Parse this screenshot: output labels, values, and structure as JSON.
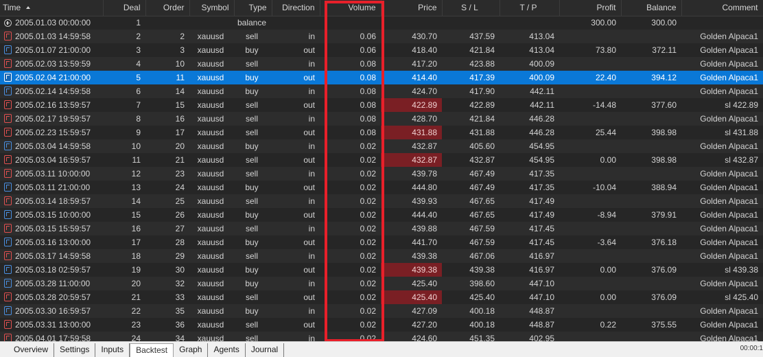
{
  "columns": {
    "time": "Time",
    "deal": "Deal",
    "order": "Order",
    "symbol": "Symbol",
    "type": "Type",
    "direction": "Direction",
    "volume": "Volume",
    "price": "Price",
    "sl": "S / L",
    "tp": "T / P",
    "profit": "Profit",
    "balance": "Balance",
    "comment": "Comment"
  },
  "rows": [
    {
      "icon": "balance",
      "time": "2005.01.03 00:00:00",
      "deal": "1",
      "order": "",
      "symbol": "",
      "type": "balance",
      "direction": "",
      "volume": "",
      "price": "",
      "sl": "",
      "tp": "",
      "profit": "300.00",
      "balance": "300.00",
      "comment": "",
      "selected": false,
      "loss": false
    },
    {
      "icon": "sell",
      "time": "2005.01.03 14:59:58",
      "deal": "2",
      "order": "2",
      "symbol": "xauusd",
      "type": "sell",
      "direction": "in",
      "volume": "0.06",
      "price": "430.70",
      "sl": "437.59",
      "tp": "413.04",
      "profit": "",
      "balance": "",
      "comment": "Golden Alpaca1",
      "selected": false,
      "loss": false
    },
    {
      "icon": "buy",
      "time": "2005.01.07 21:00:00",
      "deal": "3",
      "order": "3",
      "symbol": "xauusd",
      "type": "buy",
      "direction": "out",
      "volume": "0.06",
      "price": "418.40",
      "sl": "421.84",
      "tp": "413.04",
      "profit": "73.80",
      "balance": "372.11",
      "comment": "Golden Alpaca1",
      "selected": false,
      "loss": false
    },
    {
      "icon": "sell",
      "time": "2005.02.03 13:59:59",
      "deal": "4",
      "order": "10",
      "symbol": "xauusd",
      "type": "sell",
      "direction": "in",
      "volume": "0.08",
      "price": "417.20",
      "sl": "423.88",
      "tp": "400.09",
      "profit": "",
      "balance": "",
      "comment": "Golden Alpaca1",
      "selected": false,
      "loss": false
    },
    {
      "icon": "buy",
      "time": "2005.02.04 21:00:00",
      "deal": "5",
      "order": "11",
      "symbol": "xauusd",
      "type": "buy",
      "direction": "out",
      "volume": "0.08",
      "price": "414.40",
      "sl": "417.39",
      "tp": "400.09",
      "profit": "22.40",
      "balance": "394.12",
      "comment": "Golden Alpaca1",
      "selected": true,
      "loss": false
    },
    {
      "icon": "buy",
      "time": "2005.02.14 14:59:58",
      "deal": "6",
      "order": "14",
      "symbol": "xauusd",
      "type": "buy",
      "direction": "in",
      "volume": "0.08",
      "price": "424.70",
      "sl": "417.90",
      "tp": "442.11",
      "profit": "",
      "balance": "",
      "comment": "Golden Alpaca1",
      "selected": false,
      "loss": false
    },
    {
      "icon": "sell",
      "time": "2005.02.16 13:59:57",
      "deal": "7",
      "order": "15",
      "symbol": "xauusd",
      "type": "sell",
      "direction": "out",
      "volume": "0.08",
      "price": "422.89",
      "sl": "422.89",
      "tp": "442.11",
      "profit": "-14.48",
      "balance": "377.60",
      "comment": "sl 422.89",
      "selected": false,
      "loss": true
    },
    {
      "icon": "sell",
      "time": "2005.02.17 19:59:57",
      "deal": "8",
      "order": "16",
      "symbol": "xauusd",
      "type": "sell",
      "direction": "in",
      "volume": "0.08",
      "price": "428.70",
      "sl": "421.84",
      "tp": "446.28",
      "profit": "",
      "balance": "",
      "comment": "Golden Alpaca1",
      "selected": false,
      "loss": false
    },
    {
      "icon": "sell",
      "time": "2005.02.23 15:59:57",
      "deal": "9",
      "order": "17",
      "symbol": "xauusd",
      "type": "sell",
      "direction": "out",
      "volume": "0.08",
      "price": "431.88",
      "sl": "431.88",
      "tp": "446.28",
      "profit": "25.44",
      "balance": "398.98",
      "comment": "sl 431.88",
      "selected": false,
      "loss": true
    },
    {
      "icon": "buy",
      "time": "2005.03.04 14:59:58",
      "deal": "10",
      "order": "20",
      "symbol": "xauusd",
      "type": "buy",
      "direction": "in",
      "volume": "0.02",
      "price": "432.87",
      "sl": "405.60",
      "tp": "454.95",
      "profit": "",
      "balance": "",
      "comment": "Golden Alpaca1",
      "selected": false,
      "loss": false
    },
    {
      "icon": "sell",
      "time": "2005.03.04 16:59:57",
      "deal": "11",
      "order": "21",
      "symbol": "xauusd",
      "type": "sell",
      "direction": "out",
      "volume": "0.02",
      "price": "432.87",
      "sl": "432.87",
      "tp": "454.95",
      "profit": "0.00",
      "balance": "398.98",
      "comment": "sl 432.87",
      "selected": false,
      "loss": true
    },
    {
      "icon": "sell",
      "time": "2005.03.11 10:00:00",
      "deal": "12",
      "order": "23",
      "symbol": "xauusd",
      "type": "sell",
      "direction": "in",
      "volume": "0.02",
      "price": "439.78",
      "sl": "467.49",
      "tp": "417.35",
      "profit": "",
      "balance": "",
      "comment": "Golden Alpaca1",
      "selected": false,
      "loss": false
    },
    {
      "icon": "buy",
      "time": "2005.03.11 21:00:00",
      "deal": "13",
      "order": "24",
      "symbol": "xauusd",
      "type": "buy",
      "direction": "out",
      "volume": "0.02",
      "price": "444.80",
      "sl": "467.49",
      "tp": "417.35",
      "profit": "-10.04",
      "balance": "388.94",
      "comment": "Golden Alpaca1",
      "selected": false,
      "loss": false
    },
    {
      "icon": "sell",
      "time": "2005.03.14 18:59:57",
      "deal": "14",
      "order": "25",
      "symbol": "xauusd",
      "type": "sell",
      "direction": "in",
      "volume": "0.02",
      "price": "439.93",
      "sl": "467.65",
      "tp": "417.49",
      "profit": "",
      "balance": "",
      "comment": "Golden Alpaca1",
      "selected": false,
      "loss": false
    },
    {
      "icon": "buy",
      "time": "2005.03.15 10:00:00",
      "deal": "15",
      "order": "26",
      "symbol": "xauusd",
      "type": "buy",
      "direction": "out",
      "volume": "0.02",
      "price": "444.40",
      "sl": "467.65",
      "tp": "417.49",
      "profit": "-8.94",
      "balance": "379.91",
      "comment": "Golden Alpaca1",
      "selected": false,
      "loss": false
    },
    {
      "icon": "sell",
      "time": "2005.03.15 15:59:57",
      "deal": "16",
      "order": "27",
      "symbol": "xauusd",
      "type": "sell",
      "direction": "in",
      "volume": "0.02",
      "price": "439.88",
      "sl": "467.59",
      "tp": "417.45",
      "profit": "",
      "balance": "",
      "comment": "Golden Alpaca1",
      "selected": false,
      "loss": false
    },
    {
      "icon": "buy",
      "time": "2005.03.16 13:00:00",
      "deal": "17",
      "order": "28",
      "symbol": "xauusd",
      "type": "buy",
      "direction": "out",
      "volume": "0.02",
      "price": "441.70",
      "sl": "467.59",
      "tp": "417.45",
      "profit": "-3.64",
      "balance": "376.18",
      "comment": "Golden Alpaca1",
      "selected": false,
      "loss": false
    },
    {
      "icon": "sell",
      "time": "2005.03.17 14:59:58",
      "deal": "18",
      "order": "29",
      "symbol": "xauusd",
      "type": "sell",
      "direction": "in",
      "volume": "0.02",
      "price": "439.38",
      "sl": "467.06",
      "tp": "416.97",
      "profit": "",
      "balance": "",
      "comment": "Golden Alpaca1",
      "selected": false,
      "loss": false
    },
    {
      "icon": "buy",
      "time": "2005.03.18 02:59:57",
      "deal": "19",
      "order": "30",
      "symbol": "xauusd",
      "type": "buy",
      "direction": "out",
      "volume": "0.02",
      "price": "439.38",
      "sl": "439.38",
      "tp": "416.97",
      "profit": "0.00",
      "balance": "376.09",
      "comment": "sl 439.38",
      "selected": false,
      "loss": true
    },
    {
      "icon": "buy",
      "time": "2005.03.28 11:00:00",
      "deal": "20",
      "order": "32",
      "symbol": "xauusd",
      "type": "buy",
      "direction": "in",
      "volume": "0.02",
      "price": "425.40",
      "sl": "398.60",
      "tp": "447.10",
      "profit": "",
      "balance": "",
      "comment": "Golden Alpaca1",
      "selected": false,
      "loss": false
    },
    {
      "icon": "sell",
      "time": "2005.03.28 20:59:57",
      "deal": "21",
      "order": "33",
      "symbol": "xauusd",
      "type": "sell",
      "direction": "out",
      "volume": "0.02",
      "price": "425.40",
      "sl": "425.40",
      "tp": "447.10",
      "profit": "0.00",
      "balance": "376.09",
      "comment": "sl 425.40",
      "selected": false,
      "loss": true
    },
    {
      "icon": "buy",
      "time": "2005.03.30 16:59:57",
      "deal": "22",
      "order": "35",
      "symbol": "xauusd",
      "type": "buy",
      "direction": "in",
      "volume": "0.02",
      "price": "427.09",
      "sl": "400.18",
      "tp": "448.87",
      "profit": "",
      "balance": "",
      "comment": "Golden Alpaca1",
      "selected": false,
      "loss": false
    },
    {
      "icon": "sell",
      "time": "2005.03.31 13:00:00",
      "deal": "23",
      "order": "36",
      "symbol": "xauusd",
      "type": "sell",
      "direction": "out",
      "volume": "0.02",
      "price": "427.20",
      "sl": "400.18",
      "tp": "448.87",
      "profit": "0.22",
      "balance": "375.55",
      "comment": "Golden Alpaca1",
      "selected": false,
      "loss": false
    },
    {
      "icon": "sell",
      "time": "2005.04.01 17:59:58",
      "deal": "24",
      "order": "34",
      "symbol": "xauusd",
      "type": "sell",
      "direction": "in",
      "volume": "0.02",
      "price": "424.60",
      "sl": "451.35",
      "tp": "402.95",
      "profit": "",
      "balance": "",
      "comment": "Golden Alpaca1",
      "selected": false,
      "loss": false
    }
  ],
  "tabs": [
    {
      "label": "Overview",
      "active": false
    },
    {
      "label": "Settings",
      "active": false
    },
    {
      "label": "Inputs",
      "active": false
    },
    {
      "label": "Backtest",
      "active": true
    },
    {
      "label": "Graph",
      "active": false
    },
    {
      "label": "Agents",
      "active": false
    },
    {
      "label": "Journal",
      "active": false
    }
  ],
  "status_right": "00:00:1",
  "colors": {
    "selected_row": "#0a78d7",
    "loss_price_cell": "#7a1f24",
    "highlight_box": "#e8202a",
    "sell_icon": "#e05050",
    "buy_icon": "#4a8fe0"
  }
}
